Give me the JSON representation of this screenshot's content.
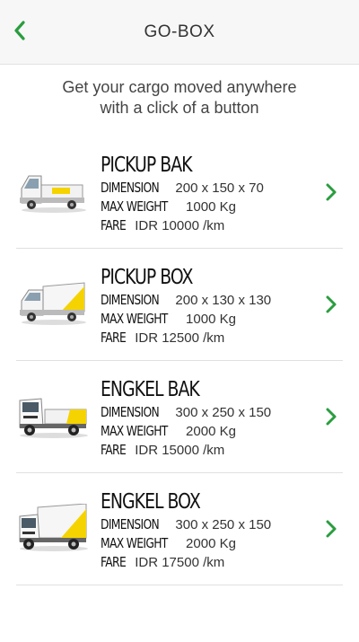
{
  "header": {
    "title": "GO-BOX",
    "back_icon": "chevron-left-icon",
    "accent_color": "#2a9d3f"
  },
  "tagline": {
    "line1": "Get your cargo moved anywhere",
    "line2": "with a click of a button"
  },
  "labels": {
    "dimension": "DIMENSION",
    "max_weight": "MAX WEIGHT",
    "fare": "FARE"
  },
  "vehicles": [
    {
      "name": "PICKUP BAK",
      "dimension": "200 x 150 x 70",
      "max_weight": "1000 Kg",
      "fare": "IDR 10000 /km",
      "icon": "pickup-bak-truck-icon"
    },
    {
      "name": "PICKUP BOX",
      "dimension": "200 x 130 x 130",
      "max_weight": "1000 Kg",
      "fare": "IDR 12500 /km",
      "icon": "pickup-box-truck-icon"
    },
    {
      "name": "ENGKEL BAK",
      "dimension": "300 x 250 x 150",
      "max_weight": "2000 Kg",
      "fare": "IDR 15000 /km",
      "icon": "engkel-bak-truck-icon"
    },
    {
      "name": "ENGKEL BOX",
      "dimension": "300 x 250 x 150",
      "max_weight": "2000 Kg",
      "fare": "IDR 17500 /km",
      "icon": "engkel-box-truck-icon"
    }
  ]
}
